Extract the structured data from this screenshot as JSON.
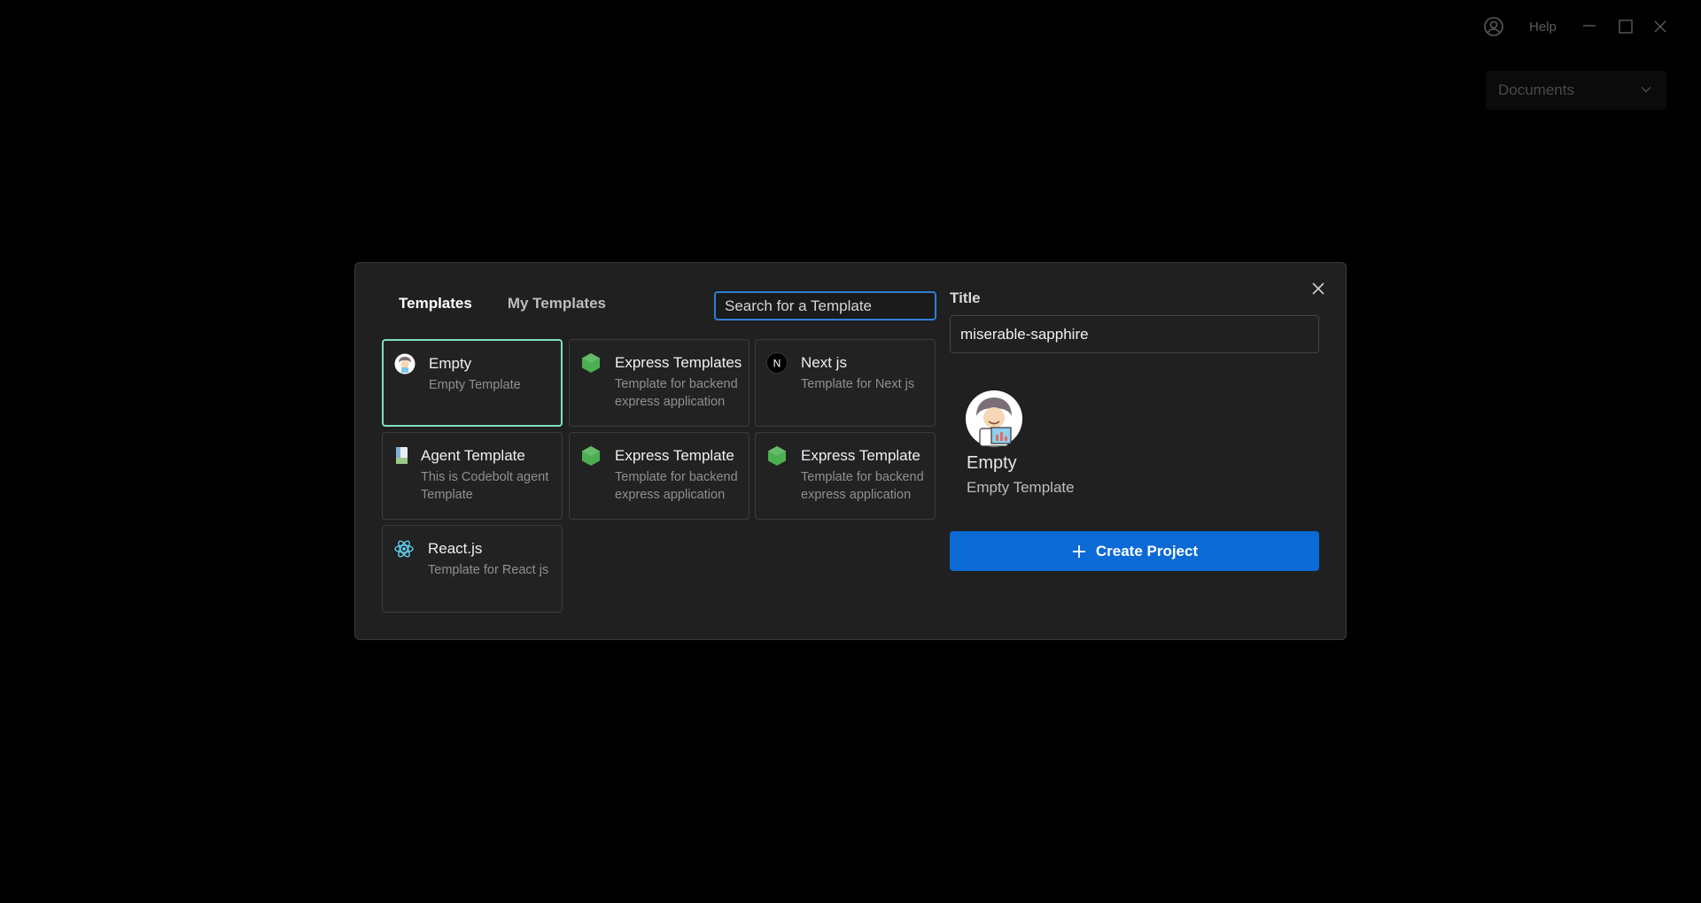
{
  "titlebar": {
    "help_label": "Help",
    "folder_select": "Documents"
  },
  "modal": {
    "tabs": [
      {
        "label": "Templates",
        "active": true
      },
      {
        "label": "My Templates",
        "active": false
      }
    ],
    "search": {
      "placeholder": "Search for a Template",
      "value": ""
    },
    "templates": [
      {
        "name": "Empty",
        "description": "Empty Template",
        "icon": "avatar-icon",
        "selected": true
      },
      {
        "name": "Express Templates",
        "description": "Template for backend express application",
        "icon": "nodejs-hexagon-icon"
      },
      {
        "name": "Next js",
        "description": "Template for Next js",
        "icon": "nextjs-logo-icon"
      },
      {
        "name": "Agent Template",
        "description": "This is Codebolt agent Template",
        "icon": "document-icon"
      },
      {
        "name": "Express Template",
        "description": "Template for backend express application",
        "icon": "nodejs-hexagon-icon"
      },
      {
        "name": "Express Template",
        "description": "Template for backend express application",
        "icon": "nodejs-hexagon-icon"
      },
      {
        "name": "React.js",
        "description": "Template for React js",
        "icon": "react-atom-icon"
      }
    ],
    "title_label": "Title",
    "title_value": "miserable-sapphire",
    "preview": {
      "name": "Empty",
      "description": "Empty Template"
    },
    "create_button_label": "Create Project"
  },
  "colors": {
    "accent_blue": "#0b6ad6",
    "selected_border": "#7fe0b8",
    "node_green": "#4caf50",
    "react_cyan": "#61dafb"
  }
}
